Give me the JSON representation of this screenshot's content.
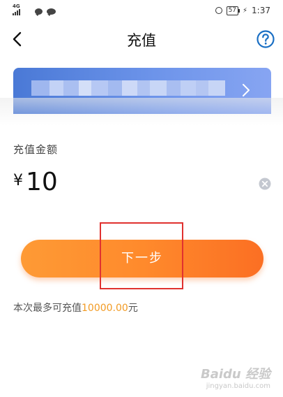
{
  "status_bar": {
    "network_type": "4G",
    "battery": "57",
    "time": "1:37"
  },
  "header": {
    "title": "充值",
    "back_icon": "chevron-left-icon",
    "help_icon": "question-circle-icon"
  },
  "card": {
    "account_text_obscured": true,
    "arrow_icon": "chevron-right-icon",
    "gradient_start": "#4a79d6",
    "gradient_end": "#87a5f2"
  },
  "amount": {
    "label": "充值金额",
    "currency": "¥",
    "value": "10",
    "clear_icon": "clear-circle-icon"
  },
  "next_button": {
    "label": "下一步",
    "gradient_start": "#fe9a35",
    "gradient_end": "#fb6f23"
  },
  "limit": {
    "prefix": "本次最多可充值",
    "amount": "10000.00",
    "suffix": "元"
  },
  "watermark": {
    "brand": "Baidu 经验",
    "url": "jingyan.baidu.com"
  },
  "colors": {
    "accent_orange": "#ff8a2c",
    "limit_highlight": "#f29b24",
    "highlight_box": "#e0312f"
  }
}
